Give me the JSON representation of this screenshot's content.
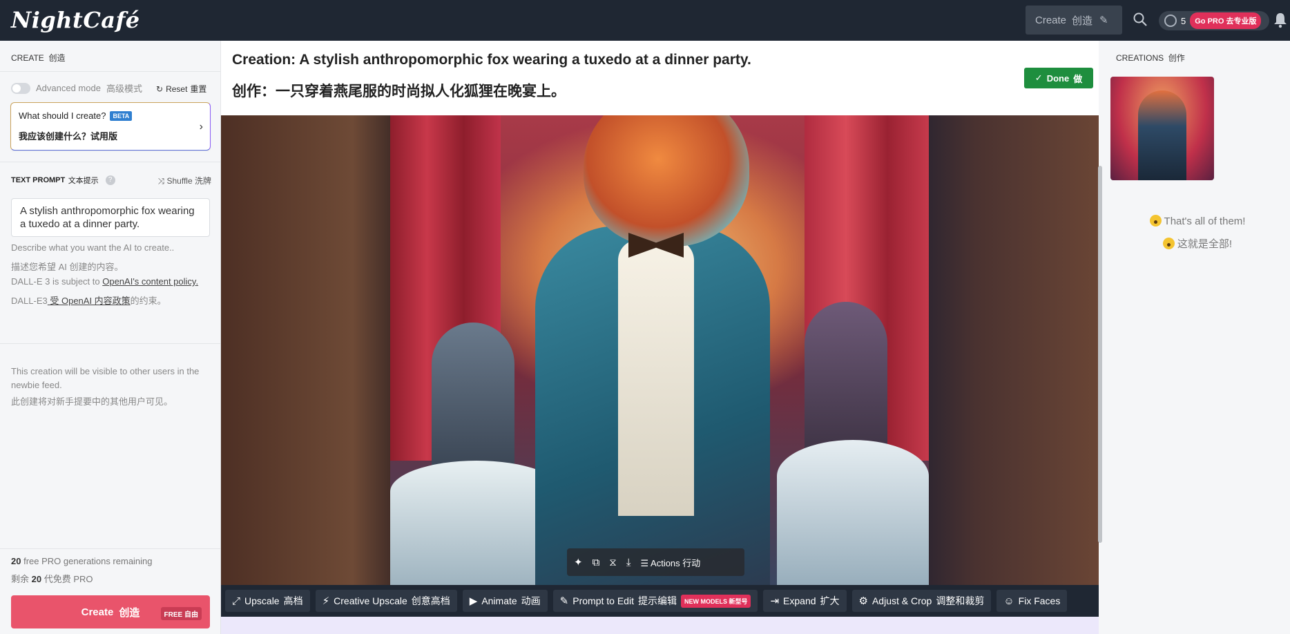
{
  "header": {
    "logo": "NightCafé",
    "create_label": "Create",
    "create_label_cn": "创造",
    "credits": "5",
    "gopro_label": "Go PRO",
    "gopro_label_cn": "去专业版"
  },
  "sidebar": {
    "create_title": "CREATE",
    "create_title_cn": "创造",
    "advanced_mode": "Advanced mode",
    "advanced_mode_cn": "高级模式",
    "reset": "Reset",
    "reset_cn": "重置",
    "suggest_title": "What should I create?",
    "suggest_badge": "BETA",
    "suggest_cn": "我应该创建什么？试用版",
    "text_prompt_label": "TEXT PROMPT",
    "text_prompt_label_cn": "文本提示",
    "shuffle": "Shuffle",
    "shuffle_cn": "洗牌",
    "prompt_value": "A stylish anthropomorphic fox wearing a tuxedo at a dinner party.",
    "describe_hint": "Describe what you want the AI to create..",
    "describe_hint_cn": "描述您希望 AI 创建的内容。",
    "policy_prefix": "DALL-E 3 is subject to ",
    "policy_link": "OpenAI's content policy.",
    "policy_cn_prefix": "DALL-E3",
    "policy_cn_link": " 受 OpenAI 内容政策",
    "policy_cn_suffix": "的约束。",
    "visibility_note": "This creation will be visible to other users in the newbie feed.",
    "visibility_note_cn": "此创建将对新手提要中的其他用户可见。",
    "gens_count": "20",
    "gens_text": " free PRO generations remaining",
    "gens_cn_prefix": "剩余 ",
    "gens_cn_count": "20",
    "gens_cn_suffix": " 代免费 PRO",
    "create_button": "Create",
    "create_button_cn": "创造",
    "free_badge": "FREE 自由"
  },
  "main": {
    "title_en": "Creation: A stylish anthropomorphic fox wearing a tuxedo at a dinner party.",
    "title_cn": "创作：一只穿着燕尾服的时尚拟人化狐狸在晚宴上。",
    "done_label": "Done",
    "done_label_cn": "做",
    "image_actions_label": "Actions",
    "image_actions_label_cn": "行动",
    "actions": [
      {
        "label": "Upscale",
        "cn": "高档",
        "icon": "expand-icon"
      },
      {
        "label": "Creative Upscale",
        "cn": "创意高档",
        "icon": "magic-wand-icon"
      },
      {
        "label": "Animate",
        "cn": "动画",
        "icon": "video-icon"
      },
      {
        "label": "Prompt to Edit",
        "cn": "提示编辑",
        "icon": "edit-icon",
        "badge": "NEW MODELS 新型号"
      },
      {
        "label": "Expand",
        "cn": "扩大",
        "icon": "expand-right-icon"
      },
      {
        "label": "Adjust & Crop",
        "cn": "调整和裁剪",
        "icon": "gear-icon"
      },
      {
        "label": "Fix Faces",
        "cn": "",
        "icon": "face-icon"
      }
    ]
  },
  "right_panel": {
    "title": "CREATIONS",
    "title_cn": "创作",
    "end_note": "That's all of them!",
    "end_note_cn": "这就是全部!"
  }
}
